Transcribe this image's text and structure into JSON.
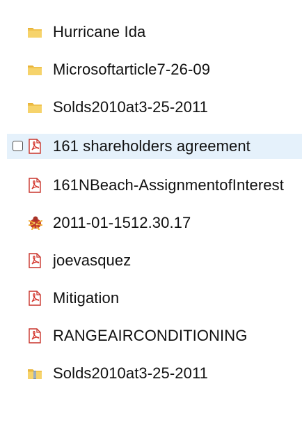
{
  "colors": {
    "folder": "#e8b33a",
    "folder_light": "#f6d36b",
    "pdf_red": "#d4342b",
    "selected_bg": "#e5f1fb"
  },
  "items": [
    {
      "name": "Hurricane Ida",
      "icon": "folder-icon"
    },
    {
      "name": "Microsoftarticle7-26-09",
      "icon": "folder-icon"
    },
    {
      "name": "Solds2010at3-25-2011",
      "icon": "folder-icon"
    },
    {
      "name": "161 shareholders agreement",
      "icon": "pdf-file-icon",
      "selected": true
    },
    {
      "name": "161NBeach-AssignmentofInterest",
      "icon": "pdf-file-icon"
    },
    {
      "name": "2011-01-1512.30.17",
      "icon": "app-bug-icon"
    },
    {
      "name": "joevasquez",
      "icon": "pdf-file-icon"
    },
    {
      "name": "Mitigation",
      "icon": "pdf-file-icon"
    },
    {
      "name": "RANGEAIRCONDITIONING",
      "icon": "pdf-file-icon"
    },
    {
      "name": "Solds2010at3-25-2011",
      "icon": "zip-folder-icon"
    }
  ]
}
